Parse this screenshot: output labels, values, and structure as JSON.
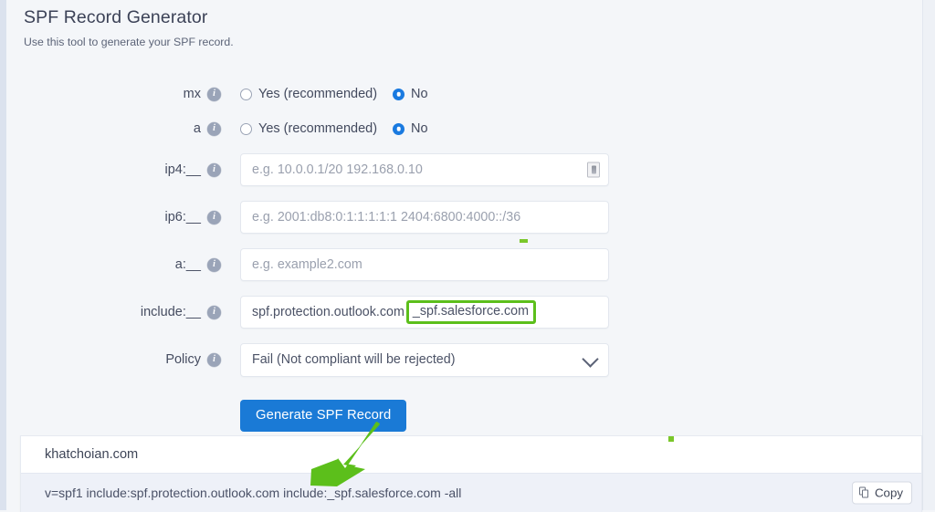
{
  "header": {
    "title": "SPF Record Generator",
    "subtitle": "Use this tool to generate your SPF record."
  },
  "form": {
    "rows": [
      {
        "label": "mx",
        "type": "radio",
        "options": [
          "Yes (recommended)",
          "No"
        ],
        "selected": "No"
      },
      {
        "label": "a",
        "type": "radio",
        "options": [
          "Yes (recommended)",
          "No"
        ],
        "selected": "No"
      },
      {
        "label": "ip4:__",
        "type": "text",
        "value": "",
        "placeholder": "e.g. 10.0.0.1/20 192.168.0.10"
      },
      {
        "label": "ip6:__",
        "type": "text",
        "value": "",
        "placeholder": "e.g. 2001:db8:0:1:1:1:1:1 2404:6800:4000::/36"
      },
      {
        "label": "a:__",
        "type": "text",
        "value": "",
        "placeholder": "e.g. example2.com"
      },
      {
        "label": "include:__",
        "type": "text-highlighted",
        "value_prefix": "spf.protection.outlook.com",
        "value_highlighted": "_spf.salesforce.com",
        "placeholder": ""
      },
      {
        "label": "Policy",
        "type": "select",
        "value": "Fail (Not compliant will be rejected)"
      }
    ],
    "mx_label": "mx",
    "a_label": "a",
    "ip4_label": "ip4:__",
    "ip4_placeholder": "e.g. 10.0.0.1/20 192.168.0.10",
    "ip6_label": "ip6:__",
    "ip6_placeholder": "e.g. 2001:db8:0:1:1:1:1:1 2404:6800:4000::/36",
    "a_field_label": "a:__",
    "a_field_placeholder": "e.g. example2.com",
    "include_label": "include:__",
    "include_value_prefix": "spf.protection.outlook.com",
    "include_value_highlighted": "_spf.salesforce.com",
    "policy_label": "Policy",
    "policy_value": "Fail (Not compliant will be rejected)",
    "radio_yes": "Yes (recommended)",
    "radio_no": "No",
    "generate_button": "Generate SPF Record"
  },
  "result": {
    "domain": "khatchoian.com",
    "record": "v=spf1 include:spf.protection.outlook.com include:_spf.salesforce.com -all",
    "copy_label": "Copy"
  },
  "colors": {
    "accent_blue": "#1a7ad6",
    "annotation_green": "#5cbf1b",
    "page_background": "#f4f6f9",
    "result_body_background": "#eef1f8",
    "info_icon": "#9aa4b8"
  }
}
